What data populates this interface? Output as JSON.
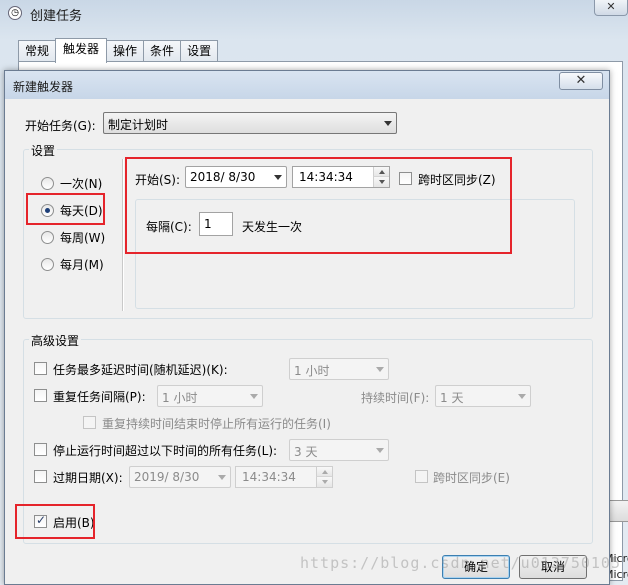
{
  "parent": {
    "title": "创建任务",
    "tabs": [
      "常规",
      "触发器",
      "操作",
      "条件",
      "设置"
    ],
    "side_text": [
      "Micro",
      "Micro"
    ]
  },
  "dialog": {
    "title": "新建触发器",
    "close_glyph": "✕",
    "begin_task": {
      "label": "开始任务(G):",
      "value": "制定计划时"
    },
    "settings": {
      "title": "设置",
      "radios": [
        {
          "label": "一次(N)",
          "checked": false
        },
        {
          "label": "每天(D)",
          "checked": true
        },
        {
          "label": "每周(W)",
          "checked": false
        },
        {
          "label": "每月(M)",
          "checked": false
        }
      ],
      "start_label": "开始(S):",
      "start_date": "2018/  8/30",
      "start_time": "14:34:34",
      "sync_tz_label": "跨时区同步(Z)",
      "interval_label": "每隔(C):",
      "interval_value": "1",
      "interval_suffix": "天发生一次"
    },
    "advanced": {
      "title": "高级设置",
      "delay_label": "任务最多延迟时间(随机延迟)(K):",
      "delay_value": "1 小时",
      "repeat_label": "重复任务间隔(P):",
      "repeat_value": "1 小时",
      "duration_label": "持续时间(F):",
      "duration_value": "1 天",
      "stop_all_label": "重复持续时间结束时停止所有运行的任务(I)",
      "stop_if_label": "停止运行时间超过以下时间的所有任务(L):",
      "stop_if_value": "3 天",
      "expire_label": "过期日期(X):",
      "expire_date": "2019/  8/30",
      "expire_time": "14:34:34",
      "expire_sync_label": "跨时区同步(E)",
      "enabled_label": "启用(B)",
      "enabled_checked": true
    },
    "ok_label": "确定",
    "cancel_label": "取消"
  },
  "watermark": "https://blog.csdn.net/u013750105",
  "colors": {
    "highlight_box": "#e5242b",
    "dialog_bg": "#f0f0f0"
  }
}
